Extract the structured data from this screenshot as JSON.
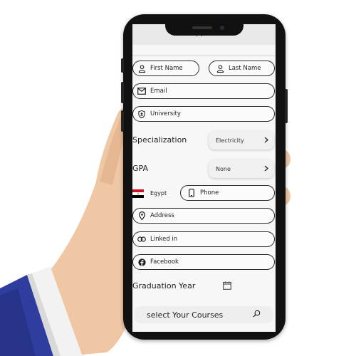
{
  "app": {
    "title": "Your App's name"
  },
  "form": {
    "first_name_placeholder": "First Name",
    "last_name_placeholder": "Last Name",
    "email_placeholder": "Email",
    "university_placeholder": "University",
    "specialization_label": "Specialization",
    "specialization_value": "Electricity",
    "gpa_label": "GPA",
    "gpa_value": "None",
    "country_name": "Egypt",
    "phone_placeholder": "Phone",
    "address_placeholder": "Address",
    "linkedin_placeholder": "Linked in",
    "facebook_placeholder": "Facebook",
    "graduation_year_label": "Graduation Year",
    "courses_label": "select Your Courses"
  },
  "icons": {
    "user": "user-icon",
    "email": "envelope-icon",
    "university": "shield-icon",
    "chevron": "chevron-right-icon",
    "flag": "egypt-flag-icon",
    "phone": "phone-icon",
    "location": "location-pin-icon",
    "link": "link-icon",
    "facebook": "facebook-icon",
    "calendar": "calendar-icon",
    "search": "search-icon"
  },
  "colors": {
    "sleeve": "#2f3e9e",
    "cuff": "#f2f2f2",
    "skin": "#f0c7a5",
    "phone_body": "#111111",
    "screen_bg": "#f7f7f7"
  }
}
